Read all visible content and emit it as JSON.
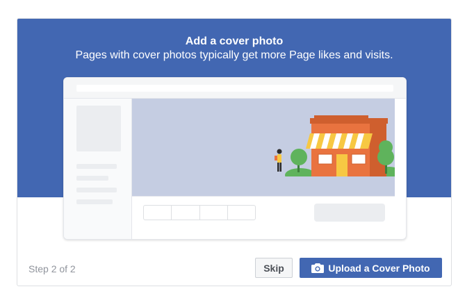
{
  "dialog": {
    "title": "Add a cover photo",
    "subtitle": "Pages with cover photos typically get more Page likes and visits."
  },
  "footer": {
    "step": "Step 2 of 2",
    "skip_label": "Skip",
    "upload_label": "Upload a Cover Photo",
    "upload_icon": "camera-icon"
  },
  "colors": {
    "brand_blue": "#4267b2",
    "cover_placeholder": "#c5cde2",
    "store_orange": "#e9733f",
    "awning_yellow": "#f7c843",
    "tree_green": "#5fb35c"
  },
  "illustration": {
    "subject": "store-front with person and trees",
    "icon_names": [
      "storefront-icon",
      "person-icon",
      "tree-icon"
    ]
  }
}
